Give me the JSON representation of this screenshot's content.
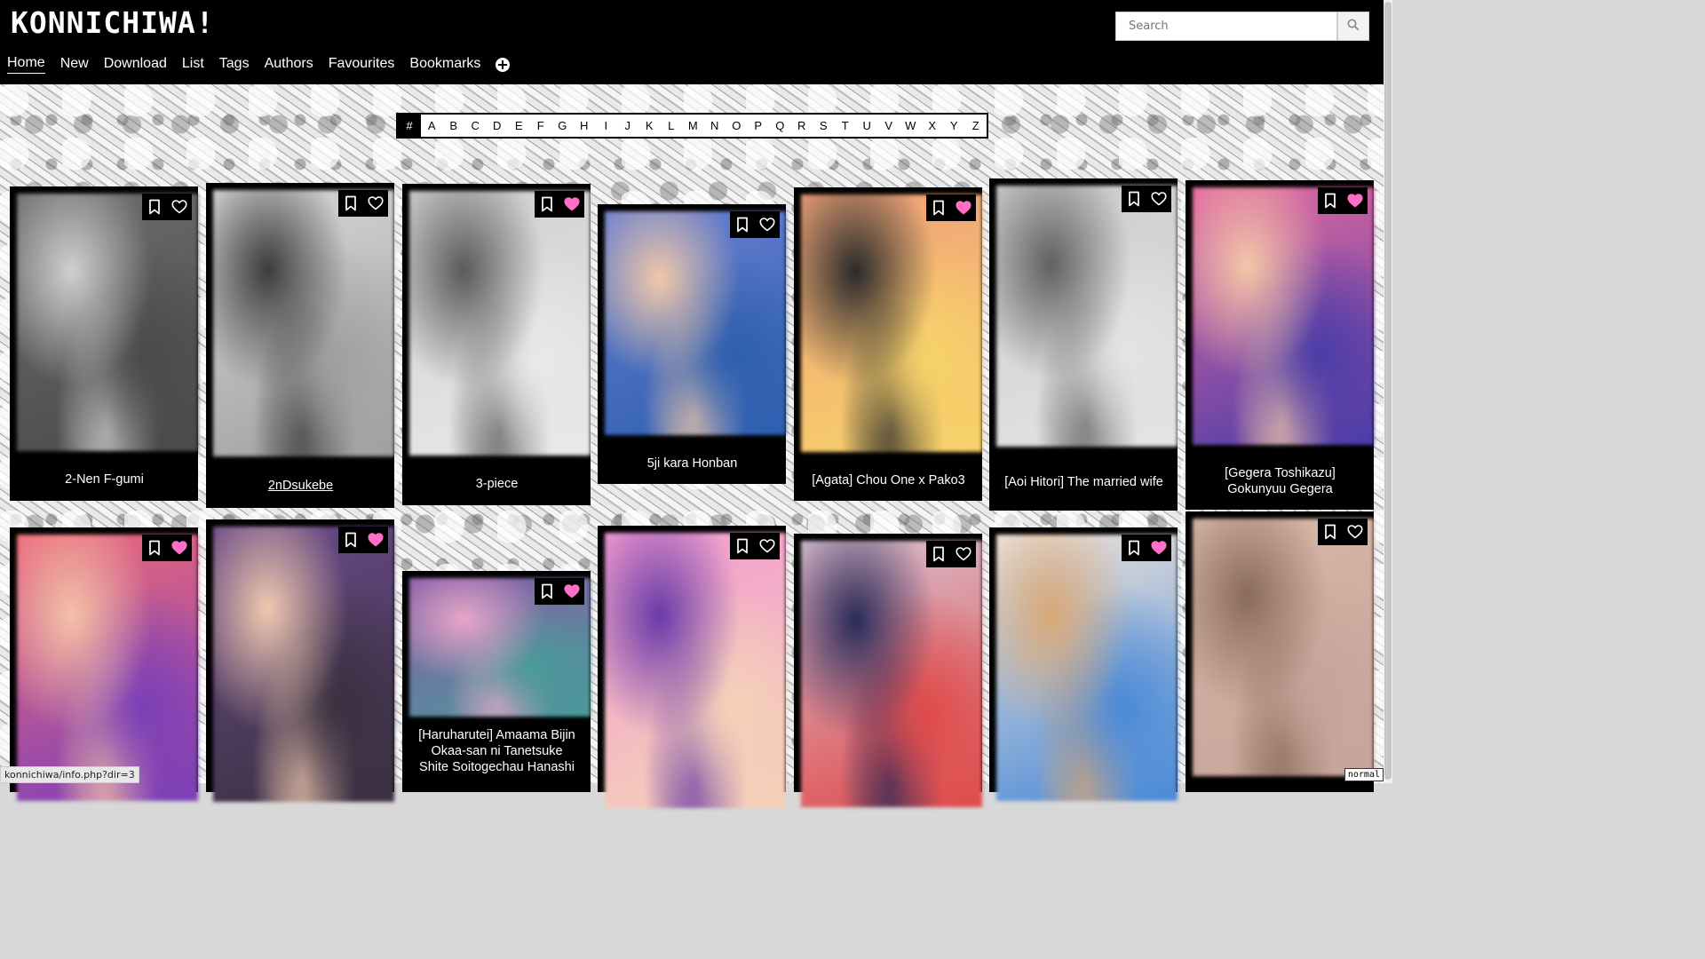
{
  "site": {
    "logo": "KONNICHIWA!"
  },
  "search": {
    "placeholder": "Search"
  },
  "nav": [
    "Home",
    "New",
    "Download",
    "List",
    "Tags",
    "Authors",
    "Favourites",
    "Bookmarks"
  ],
  "letters": [
    "#",
    "A",
    "B",
    "C",
    "D",
    "E",
    "F",
    "G",
    "H",
    "I",
    "J",
    "K",
    "L",
    "M",
    "N",
    "O",
    "P",
    "Q",
    "R",
    "S",
    "T",
    "U",
    "V",
    "W",
    "X",
    "Y",
    "Z"
  ],
  "cards_row1": [
    {
      "title": "2-Nen F-gumi",
      "favourite": false,
      "thumb": [
        "#6d6d6d",
        "#d0d0d0",
        "#4a4a4a"
      ]
    },
    {
      "title": "2nDsukebe",
      "favourite": false,
      "thumb": [
        "#d8d8d8",
        "#3c3c3c",
        "#a0a0a0"
      ]
    },
    {
      "title": "3-piece",
      "favourite": true,
      "thumb": [
        "#cfcfcf",
        "#5a5a5a",
        "#e9e9e9"
      ]
    },
    {
      "title": "5ji kara Honban",
      "favourite": false,
      "thumb": [
        "#6a7fd0",
        "#f1c9a8",
        "#2e5fb0"
      ]
    },
    {
      "title": "[Agata] Chou One x Pako3",
      "favourite": true,
      "thumb": [
        "#f0a07a",
        "#2a2a2a",
        "#f7d36a"
      ]
    },
    {
      "title": "[Aoi Hitori] The married wife",
      "favourite": false,
      "thumb": [
        "#cbcbcb",
        "#606060",
        "#e4e4e4"
      ]
    },
    {
      "title": "[Gegera Toshikazu] Gokunyuu Gegera",
      "favourite": true,
      "thumb": [
        "#e86aa0",
        "#f4c6a8",
        "#4b3ca8"
      ]
    }
  ],
  "cards_row2": [
    {
      "title": "",
      "favourite": true,
      "thumb": [
        "#f06a7a",
        "#f4c2a6",
        "#7a3fb8"
      ]
    },
    {
      "title": "",
      "favourite": true,
      "thumb": [
        "#6a4a8a",
        "#f0c9b0",
        "#3a3040"
      ]
    },
    {
      "title": "[Haruharutei] Amaama Bijin Okaa-san ni Tanetsuke Shite Soitogechau Hanashi",
      "favourite": true,
      "thumb": [
        "#8a5aa8",
        "#e8a6c8",
        "#4a9a9a"
      ]
    },
    {
      "title": "",
      "favourite": false,
      "thumb": [
        "#f29ad0",
        "#6a3aa8",
        "#f5d2b8"
      ]
    },
    {
      "title": "",
      "favourite": false,
      "thumb": [
        "#d9c2d2",
        "#2a2a5a",
        "#e04a4a"
      ]
    },
    {
      "title": "",
      "favourite": true,
      "thumb": [
        "#f0e4da",
        "#d8a878",
        "#4a8ad8"
      ]
    },
    {
      "title": "",
      "favourite": false,
      "thumb": [
        "#d8b8a8",
        "#8a6a5a",
        "#c7a49a"
      ]
    }
  ],
  "status": {
    "url": "konnichiwa/info.php?dir=3",
    "mode": "normal"
  },
  "colors": {
    "favourite": "#ff6ec7",
    "header_bg": "#000000"
  },
  "icons": {
    "bookmark": "bookmark-icon",
    "favourite": "heart-icon",
    "search": "search-icon",
    "add": "plus-circle-icon"
  }
}
